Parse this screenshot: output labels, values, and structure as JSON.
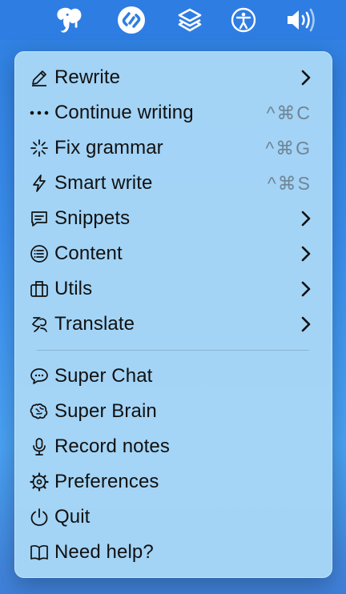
{
  "menubar": {
    "icons": [
      "elephant-app-icon",
      "shazam-icon",
      "layers-icon",
      "accessibility-icon",
      "volume-icon"
    ]
  },
  "menu": {
    "items": [
      {
        "label": "Rewrite",
        "icon": "pencil-icon",
        "submenu": true
      },
      {
        "label": "Continue writing",
        "icon": "ellipsis-icon",
        "shortcut": "^⌘C"
      },
      {
        "label": "Fix grammar",
        "icon": "sparkle-icon",
        "shortcut": "^⌘G"
      },
      {
        "label": "Smart write",
        "icon": "lightning-icon",
        "shortcut": "^⌘S"
      },
      {
        "label": "Snippets",
        "icon": "message-icon",
        "submenu": true
      },
      {
        "label": "Content",
        "icon": "list-icon",
        "submenu": true
      },
      {
        "label": "Utils",
        "icon": "briefcase-icon",
        "submenu": true
      },
      {
        "label": "Translate",
        "icon": "translate-icon",
        "submenu": true
      }
    ],
    "items2": [
      {
        "label": "Super Chat",
        "icon": "chat-icon"
      },
      {
        "label": "Super Brain",
        "icon": "brain-icon"
      },
      {
        "label": "Record notes",
        "icon": "microphone-icon"
      },
      {
        "label": "Preferences",
        "icon": "gear-icon"
      },
      {
        "label": "Quit",
        "icon": "power-icon"
      },
      {
        "label": "Need help?",
        "icon": "book-icon"
      }
    ]
  }
}
